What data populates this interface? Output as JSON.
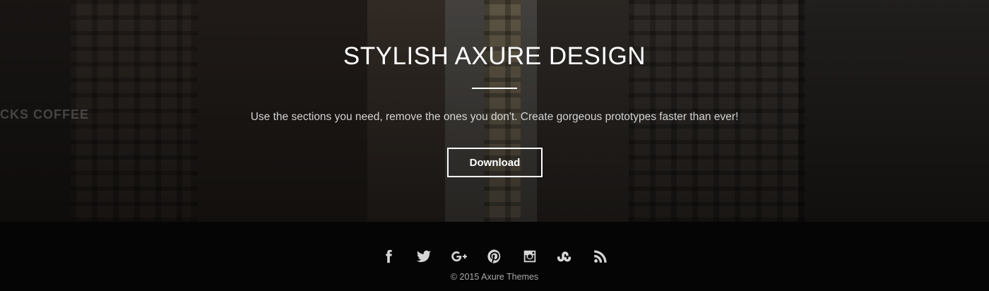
{
  "hero": {
    "title": "STYLISH AXURE DESIGN",
    "subtitle": "Use the sections you need, remove the ones you don't.  Create gorgeous prototypes faster than ever!",
    "button_label": "Download",
    "background_sign": "CKS COFFEE"
  },
  "footer": {
    "social": [
      {
        "name": "facebook-icon"
      },
      {
        "name": "twitter-icon"
      },
      {
        "name": "google-plus-icon"
      },
      {
        "name": "pinterest-icon"
      },
      {
        "name": "instagram-icon"
      },
      {
        "name": "stumbleupon-icon"
      },
      {
        "name": "rss-icon"
      }
    ],
    "copyright": "© 2015 Axure Themes"
  },
  "colors": {
    "text": "#ffffff",
    "footer_bg": "#050505",
    "icon": "#d6d6d6"
  }
}
